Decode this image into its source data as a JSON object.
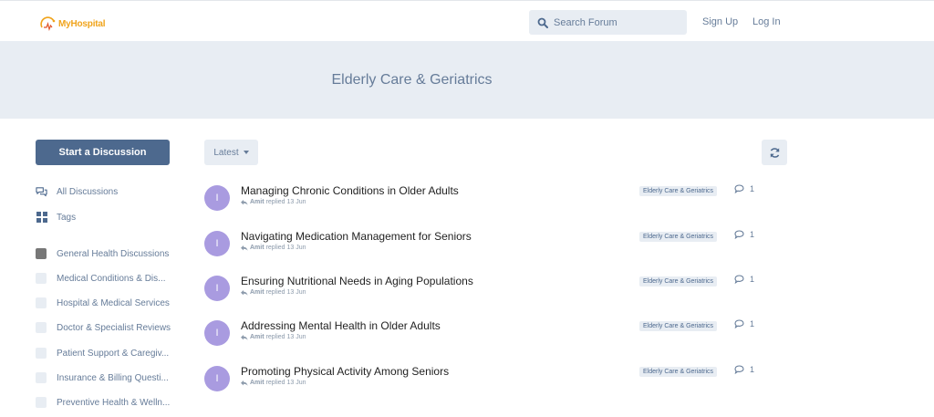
{
  "header": {
    "logo_text": "MyHospital",
    "search_placeholder": "Search Forum",
    "signup_label": "Sign Up",
    "login_label": "Log In"
  },
  "hero": {
    "title": "Elderly Care & Geriatrics"
  },
  "sidebar": {
    "start_label": "Start a Discussion",
    "nav": [
      {
        "label": "All Discussions",
        "icon": "comments-icon"
      },
      {
        "label": "Tags",
        "icon": "tags-grid-icon"
      }
    ],
    "tags": [
      {
        "label": "General Health Discussions",
        "active": true
      },
      {
        "label": "Medical Conditions & Dis...",
        "active": false
      },
      {
        "label": "Hospital & Medical Services",
        "active": false
      },
      {
        "label": "Doctor & Specialist Reviews",
        "active": false
      },
      {
        "label": "Patient Support & Caregiv...",
        "active": false
      },
      {
        "label": "Insurance & Billing Questi...",
        "active": false
      },
      {
        "label": "Preventive Health & Welln...",
        "active": false
      }
    ]
  },
  "toolbar": {
    "sort_label": "Latest"
  },
  "discussions": [
    {
      "title": "Managing Chronic Conditions in Older Adults",
      "avatar": "I",
      "author": "Amit",
      "action": "replied",
      "date": "13 Jun",
      "tag": "Elderly Care & Geriatrics",
      "count": "1"
    },
    {
      "title": "Navigating Medication Management for Seniors",
      "avatar": "I",
      "author": "Amit",
      "action": "replied",
      "date": "13 Jun",
      "tag": "Elderly Care & Geriatrics",
      "count": "1"
    },
    {
      "title": "Ensuring Nutritional Needs in Aging Populations",
      "avatar": "I",
      "author": "Amit",
      "action": "replied",
      "date": "13 Jun",
      "tag": "Elderly Care & Geriatrics",
      "count": "1"
    },
    {
      "title": "Addressing Mental Health in Older Adults",
      "avatar": "I",
      "author": "Amit",
      "action": "replied",
      "date": "13 Jun",
      "tag": "Elderly Care & Geriatrics",
      "count": "1"
    },
    {
      "title": "Promoting Physical Activity Among Seniors",
      "avatar": "I",
      "author": "Amit",
      "action": "replied",
      "date": "13 Jun",
      "tag": "Elderly Care & Geriatrics",
      "count": "1"
    }
  ],
  "colors": {
    "primary": "#4d698e",
    "secondary_bg": "#e8edf3",
    "muted_text": "#667c99",
    "avatar": "#a99be0",
    "logo": "#f0a41c"
  }
}
